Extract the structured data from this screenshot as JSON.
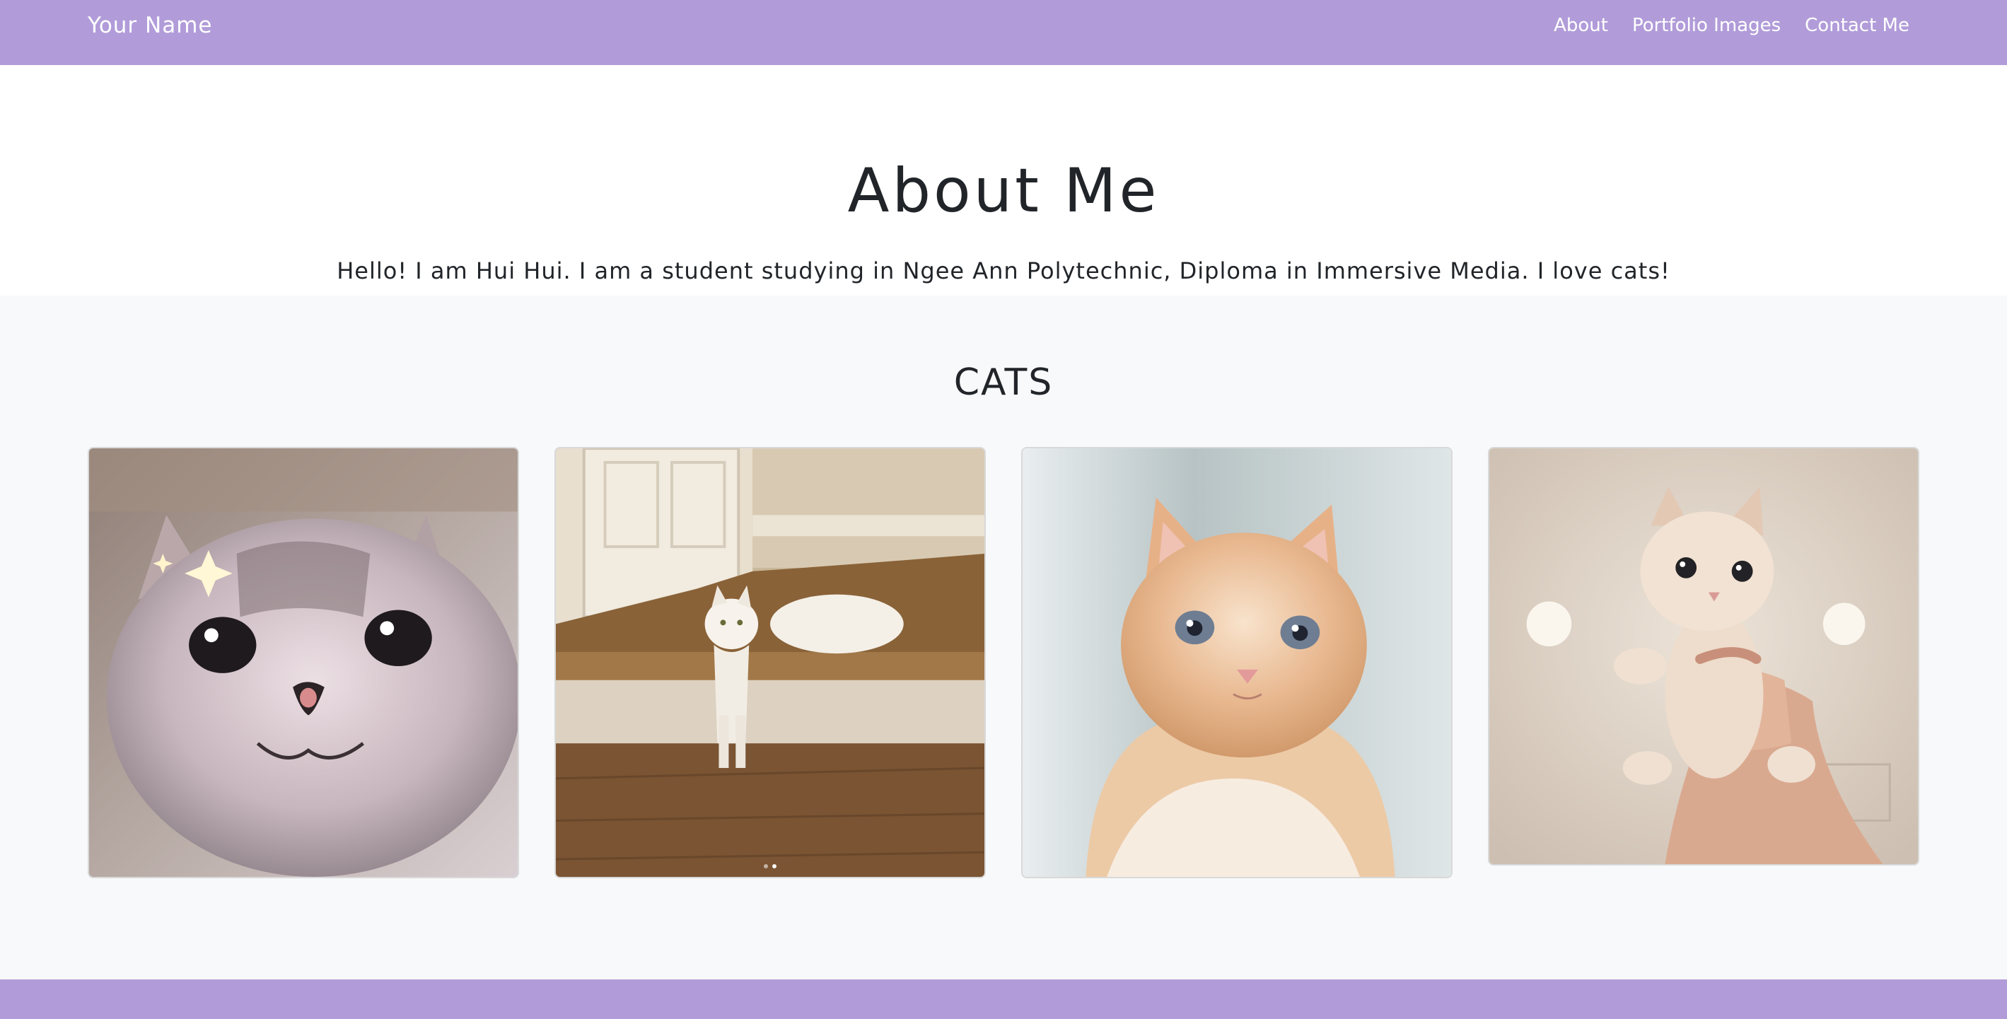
{
  "navbar": {
    "brand": "Your Name",
    "links": [
      "About",
      "Portfolio Images",
      "Contact Me"
    ],
    "color": "#b19cd9"
  },
  "about": {
    "title": "About Me",
    "text": "Hello! I am Hui Hui. I am a student studying in Ngee Ann Polytechnic, Diploma in Immersive Media. I love cats!"
  },
  "gallery": {
    "title": "CATS",
    "images": [
      {
        "icon": "sparkle-cat-selfie-photo"
      },
      {
        "icon": "white-cat-on-stairs-photo",
        "carousel_dots": 2,
        "active_dot": 2
      },
      {
        "icon": "orange-kitten-photo"
      },
      {
        "icon": "kitten-in-hand-photo"
      }
    ]
  },
  "footer": {
    "color": "#b19cd9"
  }
}
